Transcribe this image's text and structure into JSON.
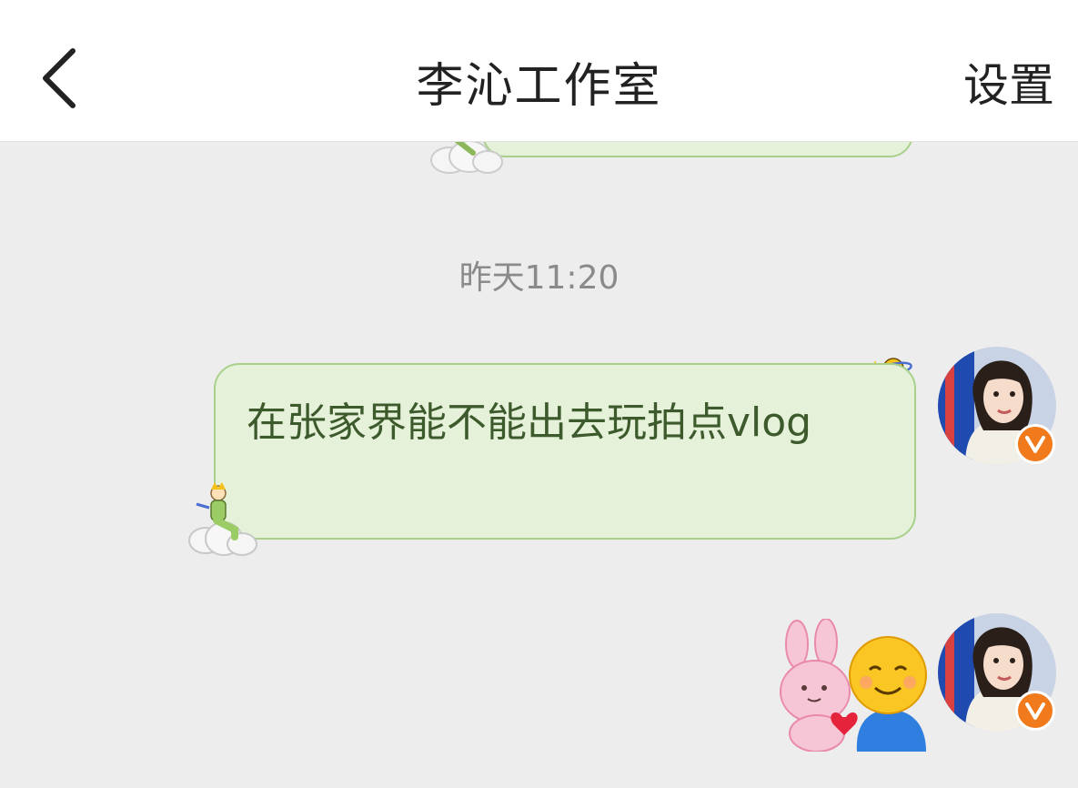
{
  "header": {
    "title": "李沁工作室",
    "settings_label": "设置",
    "back_icon": "chevron-left-icon"
  },
  "messages": [
    {
      "timestamp": "昨天11:20",
      "text": "在张家界能不能出去玩拍点vlog",
      "sender": "self",
      "bubble_bg": "#e5f1d9",
      "bubble_border": "#a8d08b",
      "text_color": "#3d5a2c",
      "verified": true
    },
    {
      "type": "sticker",
      "sticker": "bunny-hugging-smiley-sticker",
      "sender": "self",
      "verified": true
    }
  ],
  "colors": {
    "background": "#ededed",
    "header_bg": "#ffffff",
    "verified_badge": "#f07a1c",
    "timestamp": "#8a8a8a"
  }
}
